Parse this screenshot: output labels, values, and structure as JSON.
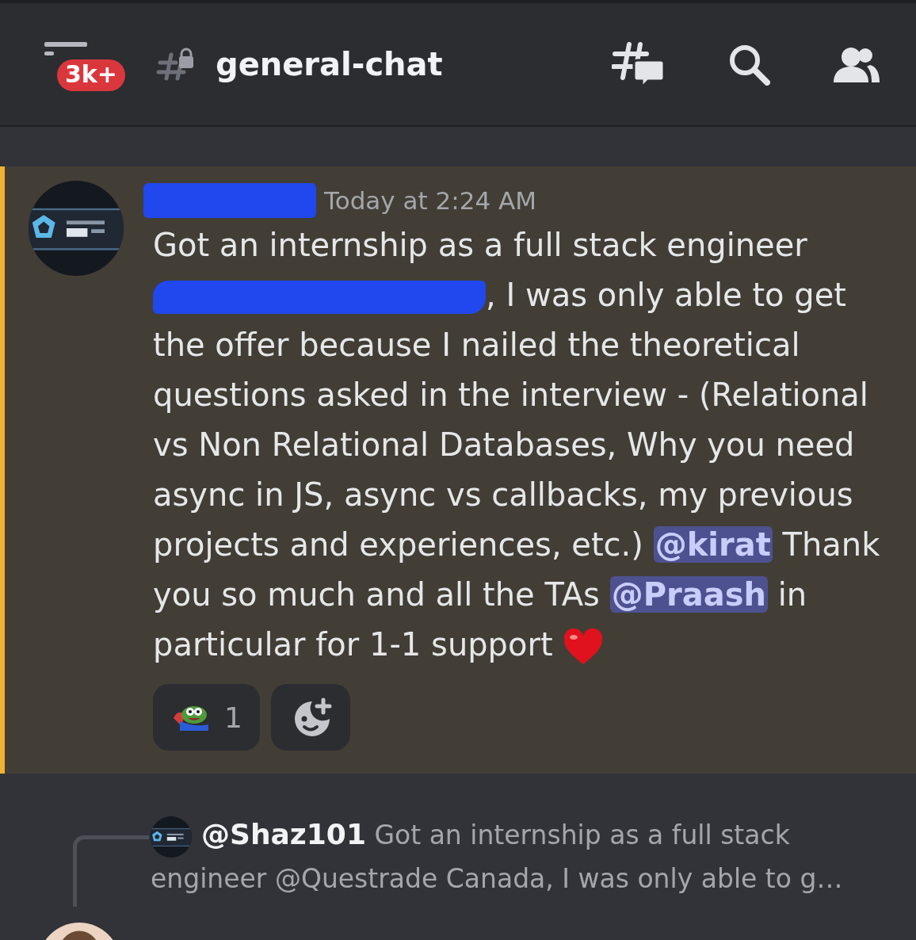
{
  "header": {
    "unread_badge": "3k+",
    "channel": "general-chat"
  },
  "message": {
    "highlighted": true,
    "author_redacted": true,
    "timestamp": "Today at 2:24 AM",
    "body": [
      {
        "kind": "text",
        "text": "Got an internship as a full stack engineer "
      },
      {
        "kind": "redaction"
      },
      {
        "kind": "text",
        "text": ", I was only able to get the offer because I nailed the theoretical questions asked in the interview - (Relational vs Non Relational Databases, Why you need async in JS, async vs callbacks, my previous projects and experiences, etc.) "
      },
      {
        "kind": "mention",
        "text": "@kirat"
      },
      {
        "kind": "text",
        "text": " Thank you so much and all the TAs "
      },
      {
        "kind": "mention",
        "text": "@Praash"
      },
      {
        "kind": "text",
        "text": " in particular for 1-1 support "
      },
      {
        "kind": "heart"
      }
    ],
    "reactions": [
      {
        "count": "1"
      }
    ]
  },
  "reply": {
    "author": "@Shaz101",
    "text": "Got an internship as a full stack engineer @Questrade Canada, I was only able to g…"
  }
}
